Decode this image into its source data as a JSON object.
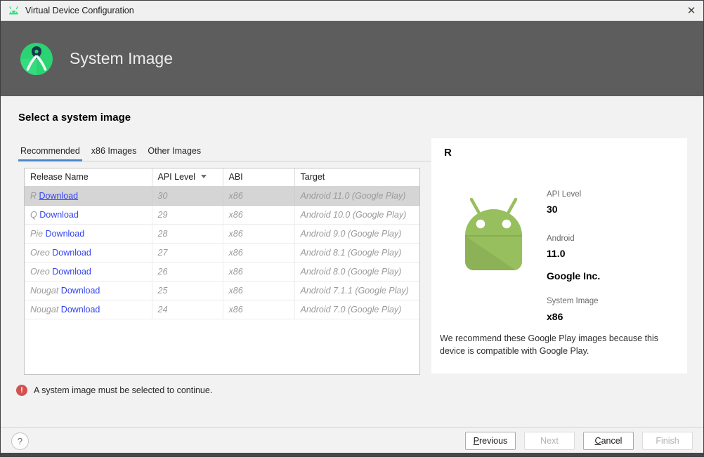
{
  "window": {
    "title": "Virtual Device Configuration",
    "close_glyph": "✕"
  },
  "header": {
    "title": "System Image"
  },
  "content": {
    "heading": "Select a system image",
    "tabs": [
      {
        "label": "Recommended",
        "selected": true
      },
      {
        "label": "x86 Images",
        "selected": false
      },
      {
        "label": "Other Images",
        "selected": false
      }
    ]
  },
  "table": {
    "columns": [
      "Release Name",
      "API Level",
      "ABI",
      "Target"
    ],
    "sorted_column": "API Level",
    "rows": [
      {
        "name": "R",
        "download": "Download",
        "api": "30",
        "abi": "x86",
        "target": "Android 11.0 (Google Play)",
        "selected": true
      },
      {
        "name": "Q",
        "download": "Download",
        "api": "29",
        "abi": "x86",
        "target": "Android 10.0 (Google Play)",
        "selected": false
      },
      {
        "name": "Pie",
        "download": "Download",
        "api": "28",
        "abi": "x86",
        "target": "Android 9.0 (Google Play)",
        "selected": false
      },
      {
        "name": "Oreo",
        "download": "Download",
        "api": "27",
        "abi": "x86",
        "target": "Android 8.1 (Google Play)",
        "selected": false
      },
      {
        "name": "Oreo",
        "download": "Download",
        "api": "26",
        "abi": "x86",
        "target": "Android 8.0 (Google Play)",
        "selected": false
      },
      {
        "name": "Nougat",
        "download": "Download",
        "api": "25",
        "abi": "x86",
        "target": "Android 7.1.1 (Google Play)",
        "selected": false
      },
      {
        "name": "Nougat",
        "download": "Download",
        "api": "24",
        "abi": "x86",
        "target": "Android 7.0 (Google Play)",
        "selected": false
      }
    ]
  },
  "details": {
    "release": "R",
    "api_label": "API Level",
    "api_value": "30",
    "android_label": "Android",
    "android_version": "11.0",
    "vendor": "Google Inc.",
    "system_image_label": "System Image",
    "system_image_value": "x86",
    "recommendation": "We recommend these Google Play images because this device is compatible with Google Play."
  },
  "error": {
    "message": "A system image must be selected to continue."
  },
  "footer": {
    "help_glyph": "?",
    "buttons": [
      {
        "label": "Previous",
        "enabled": true
      },
      {
        "label": "Next",
        "enabled": false
      },
      {
        "label": "Cancel",
        "enabled": true
      },
      {
        "label": "Finish",
        "enabled": false
      }
    ]
  },
  "colors": {
    "accent_tab_blue": "#4a88c7",
    "link_blue": "#3344ee",
    "error_red": "#d25252",
    "android_green": "#97bf5e",
    "logo_green": "#2bd473",
    "header_gray": "#5d5d5d"
  }
}
